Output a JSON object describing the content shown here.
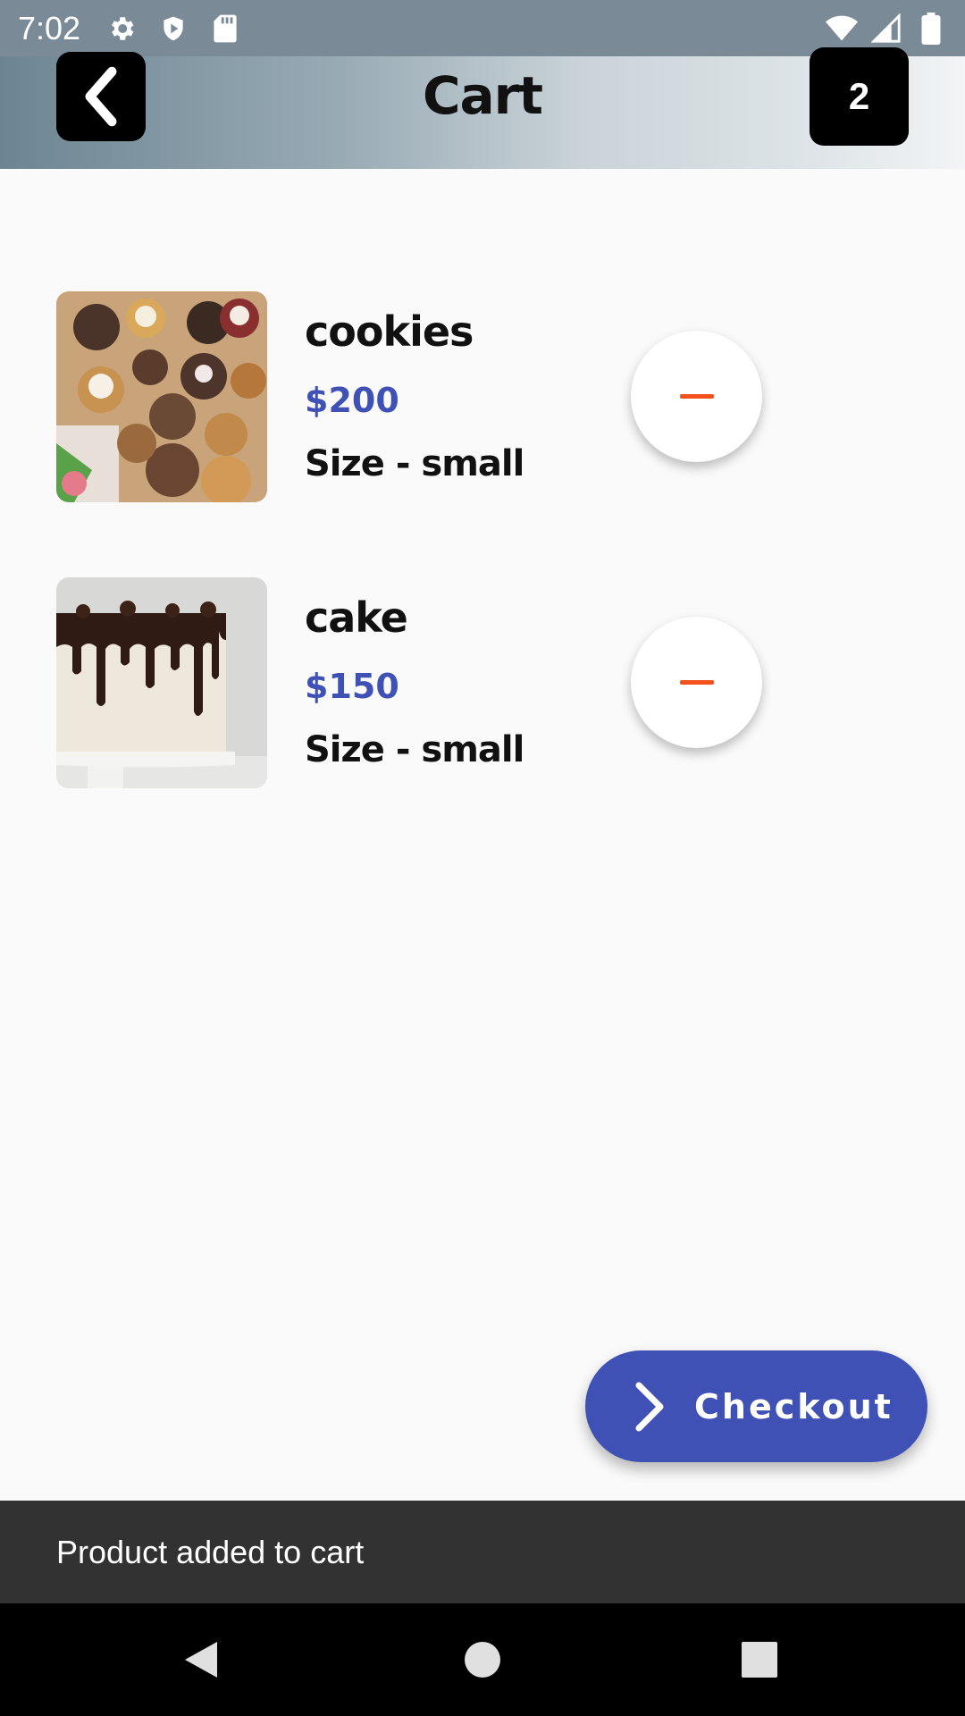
{
  "status_bar": {
    "time": "7:02",
    "icons_left": [
      "settings-icon",
      "shield-icon",
      "sd-card-icon"
    ],
    "icons_right": [
      "wifi-icon",
      "cell-signal-icon",
      "battery-icon"
    ]
  },
  "app_bar": {
    "title": "Cart",
    "back_icon": "chevron-left-icon",
    "cart_count": "2",
    "colors": {
      "badge_bg": "#000000",
      "gradient_start": "#6d8593",
      "gradient_end": "#f2f4f5"
    }
  },
  "cart": {
    "items": [
      {
        "name": "cookies",
        "price": "$200",
        "size": "Size - small",
        "image": "cookies-photo",
        "action_icon": "minus-icon"
      },
      {
        "name": "cake",
        "price": "$150",
        "size": "Size - small",
        "image": "cake-photo",
        "action_icon": "minus-icon"
      }
    ],
    "colors": {
      "price": "#3f51b5",
      "minus": "#f4511e"
    }
  },
  "checkout": {
    "label": "Checkout",
    "icon": "chevron-right-icon",
    "color": "#3f51b5"
  },
  "snackbar": {
    "message": "Product added to cart"
  },
  "nav_bar": {
    "icons": [
      "nav-back-icon",
      "nav-home-icon",
      "nav-recents-icon"
    ]
  }
}
